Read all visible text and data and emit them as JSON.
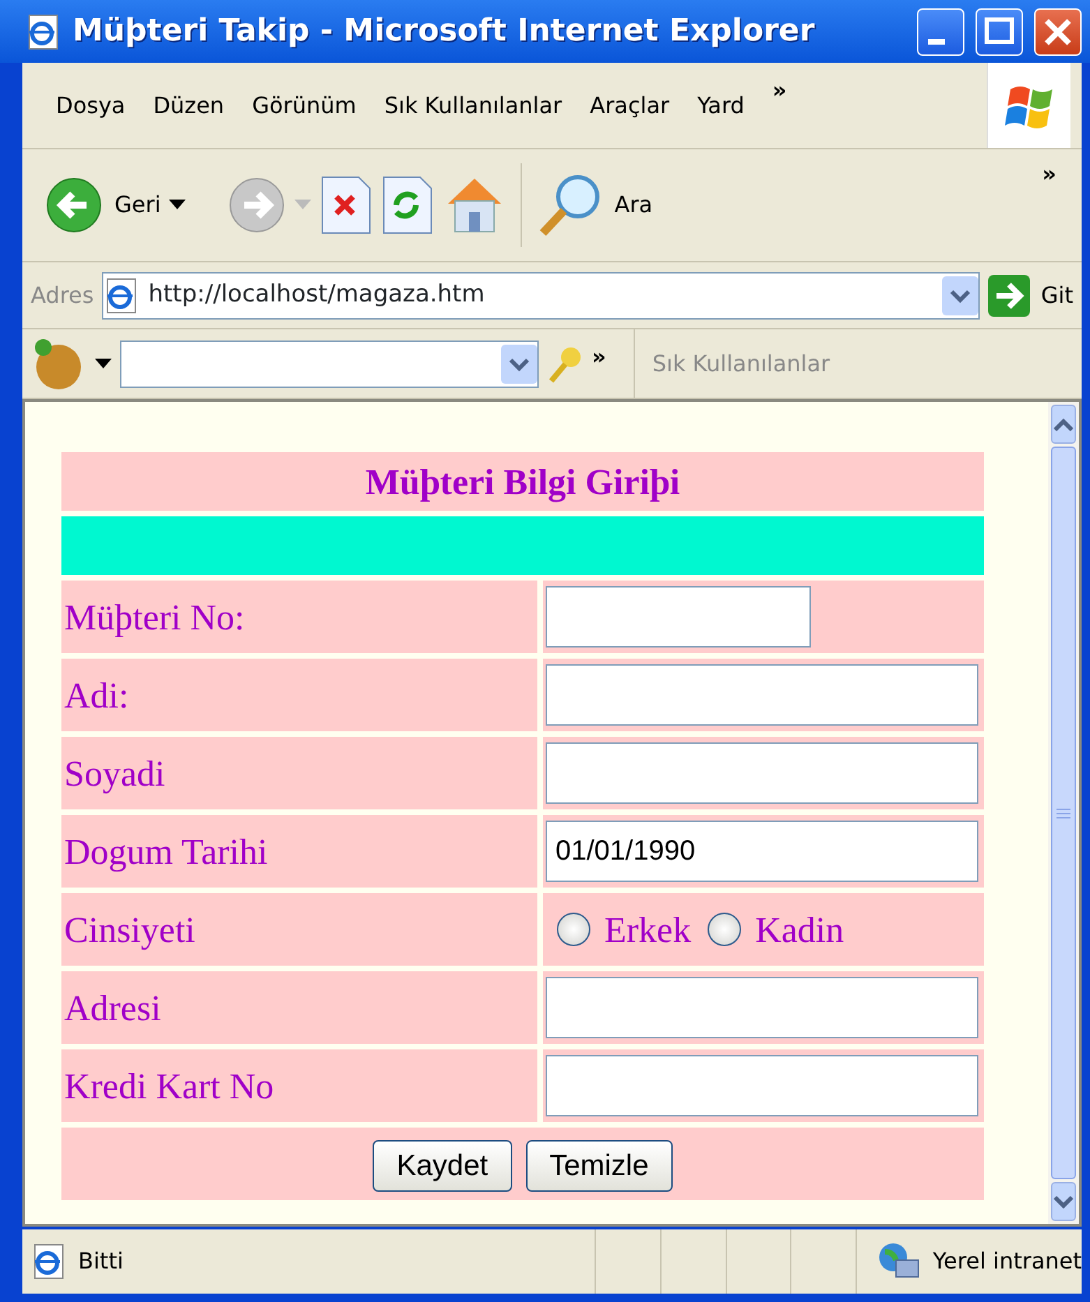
{
  "window": {
    "title": "Müþteri Takip - Microsoft Internet Explorer"
  },
  "menu": [
    {
      "label": "Dosya"
    },
    {
      "label": "Düzen"
    },
    {
      "label": "Görünüm"
    },
    {
      "label": "Sık Kullanılanlar"
    },
    {
      "label": "Araçlar"
    },
    {
      "label": "Yard"
    }
  ],
  "menu_more": "»",
  "toolbar": {
    "back": "Geri",
    "search": "Ara",
    "more": "»"
  },
  "address_bar": {
    "label": "Adres",
    "url": "http://localhost/magaza.htm",
    "go": "Git"
  },
  "links_bar": {
    "more": "»",
    "label": "Sık Kullanılanlar"
  },
  "form": {
    "title": "Müþteri Bilgi Giriþi",
    "fields": [
      {
        "kind": "short",
        "label": "Müþteri No:"
      },
      {
        "kind": "text",
        "label": "Adi:"
      },
      {
        "kind": "text",
        "label": "Soyadi"
      },
      {
        "kind": "text",
        "label": "Dogum Tarihi",
        "value": "01/01/1990"
      },
      {
        "kind": "radio",
        "label": "Cinsiyeti",
        "options": [
          {
            "label": "Erkek",
            "selected": false
          },
          {
            "label": "Kadin",
            "selected": false
          }
        ]
      },
      {
        "kind": "text",
        "label": "Adresi"
      },
      {
        "kind": "text",
        "label": "Kredi Kart No"
      }
    ],
    "buttons": [
      "Kaydet",
      "Temizle"
    ]
  },
  "status_bar": {
    "text": "Bitti",
    "zone": "Yerel intranet"
  }
}
